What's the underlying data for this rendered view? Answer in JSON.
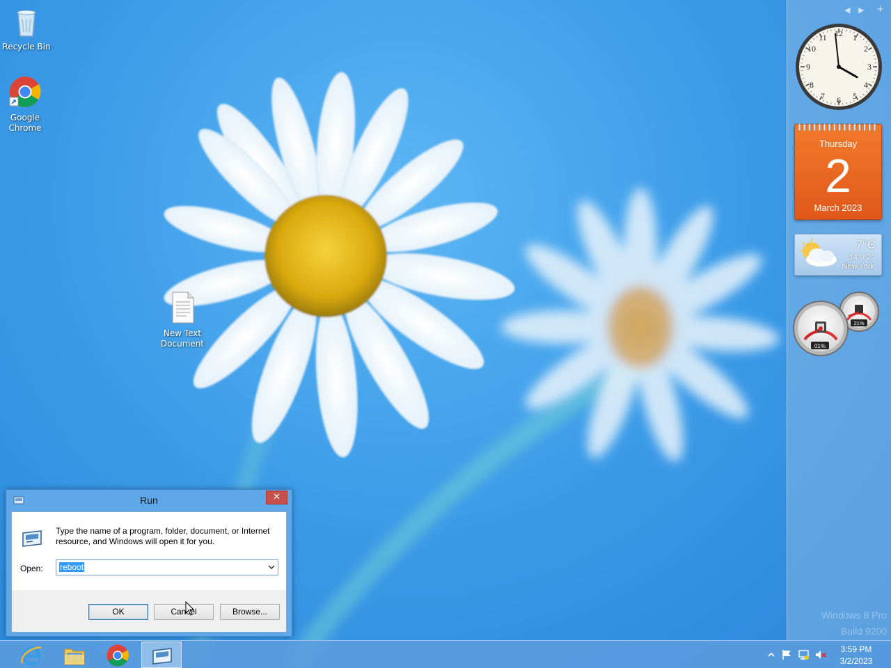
{
  "desktop": {
    "icons": [
      {
        "label": "Recycle Bin"
      },
      {
        "label": "Google Chrome"
      },
      {
        "label": "New Text Document"
      }
    ]
  },
  "sidebar": {
    "calendar": {
      "weekday": "Thursday",
      "day": "2",
      "month_year": "March 2023"
    },
    "weather": {
      "temp": "7°C",
      "range": "14° / 2°",
      "city": "New York"
    },
    "meters": {
      "cpu": "01%",
      "memory": "21%"
    },
    "clock": {
      "hour": 3,
      "minute": 59
    }
  },
  "watermark": {
    "line1": "Windows 8 Pro",
    "line2": "Build 9200"
  },
  "run_dialog": {
    "title": "Run",
    "close_glyph": "✕",
    "description": "Type the name of a program, folder, document, or Internet resource, and Windows will open it for you.",
    "open_label": "Open:",
    "open_value": "reboot",
    "ok_label": "OK",
    "cancel_label": "Cancel",
    "browse_label": "Browse..."
  },
  "taskbar": {
    "apps": [
      "Internet Explorer",
      "File Explorer",
      "Google Chrome",
      "Run"
    ],
    "clock_time": "3:59 PM",
    "clock_date": "3/2/2023"
  },
  "colors": {
    "desktop": "#3d9de8",
    "calendar": "#e8661f",
    "dialog_frame": "#5ea8e9",
    "close_button": "#c7504c",
    "selection": "#3399ff"
  }
}
